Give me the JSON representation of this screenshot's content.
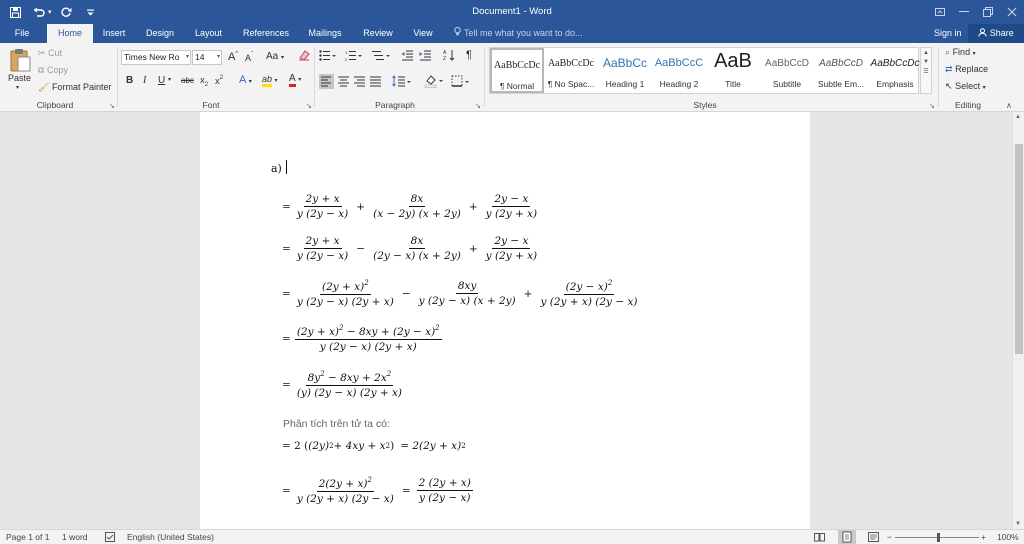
{
  "app": {
    "title": "Document1 - Word"
  },
  "qat": {
    "save_icon": "save-icon",
    "undo_icon": "undo-icon",
    "redo_icon": "redo-icon",
    "customize_icon": "customize-icon"
  },
  "tabs": [
    {
      "label": "File"
    },
    {
      "label": "Home"
    },
    {
      "label": "Insert"
    },
    {
      "label": "Design"
    },
    {
      "label": "Layout"
    },
    {
      "label": "References"
    },
    {
      "label": "Mailings"
    },
    {
      "label": "Review"
    },
    {
      "label": "View"
    }
  ],
  "tell_me": "Tell me what you want to do...",
  "sign_in": "Sign in",
  "share": "Share",
  "clipboard": {
    "paste": "Paste",
    "cut": "Cut",
    "copy": "Copy",
    "format_painter": "Format Painter",
    "label": "Clipboard"
  },
  "font": {
    "family": "Times New Ro",
    "size": "14",
    "label": "Font",
    "bold": "B",
    "italic": "I",
    "underline": "U",
    "strike": "abc",
    "subscript": "x",
    "superscript": "x",
    "grow": "A",
    "shrink": "A",
    "case": "Aa",
    "text_effects": "A",
    "highlight": "ab",
    "font_color": "A"
  },
  "paragraph": {
    "label": "Paragraph",
    "pilcrow": "¶"
  },
  "styles": {
    "label": "Styles",
    "items": [
      {
        "preview": "AaBbCcDc",
        "name": "¶ Normal"
      },
      {
        "preview": "AaBbCcDc",
        "name": "¶ No Spac..."
      },
      {
        "preview": "AaBbCc",
        "name": "Heading 1"
      },
      {
        "preview": "AaBbCcC",
        "name": "Heading 2"
      },
      {
        "preview": "AaB",
        "name": "Title"
      },
      {
        "preview": "AaBbCcD",
        "name": "Subtitle"
      },
      {
        "preview": "AaBbCcD",
        "name": "Subtle Em..."
      },
      {
        "preview": "AaBbCcDc",
        "name": "Emphasis"
      }
    ]
  },
  "editing": {
    "find": "Find",
    "replace": "Replace",
    "select": "Select",
    "label": "Editing"
  },
  "document": {
    "item_label": "a)",
    "prose": "Phân tích trên tử ta có:",
    "equations": {
      "l1": {
        "n1": "2y + x",
        "d1": "y (2y − x)",
        "n2": "8x",
        "d2": "(x − 2y) (x + 2y)",
        "n3": "2y − x",
        "d3": "y (2y + x)"
      },
      "l2": {
        "n1": "2y + x",
        "d1": "y (2y − x)",
        "n2": "8x",
        "d2": "(2y − x) (x + 2y)",
        "n3": "2y − x",
        "d3": "y (2y + x)"
      },
      "l3": {
        "n1": "(2y + x)",
        "d1": "y (2y − x) (2y + x)",
        "n2": "8xy",
        "d2": "y (2y − x) (x + 2y)",
        "n3": "(2y − x)",
        "d3": "y (2y + x) (2y − x)"
      },
      "l4": {
        "n_a": "(2y + x)",
        "n_b": " − 8xy + (2y − x)",
        "d": "y (2y − x) (2y + x)"
      },
      "l5": {
        "n_a": "8y",
        "n_b": " − 8xy + 2x",
        "d": "(y) (2y − x) (2y + x)"
      },
      "l6": {
        "a": "= 2 (",
        "b": "(2y)",
        "c": " + 4xy + x",
        "d": ")",
        "e": "= 2(2y + x)"
      },
      "l7": {
        "n1": "2(2y + x)",
        "d1": "y (2y + x) (2y − x)",
        "n2": "2 (2y + x)",
        "d2": "y (2y − x)"
      },
      "eq": "=",
      "plus": "+",
      "minus": "−",
      "sq": "2"
    }
  },
  "status": {
    "page": "Page 1 of 1",
    "words": "1 word",
    "language": "English (United States)",
    "zoom": "100%",
    "zoom_minus": "−",
    "zoom_plus": "+"
  }
}
